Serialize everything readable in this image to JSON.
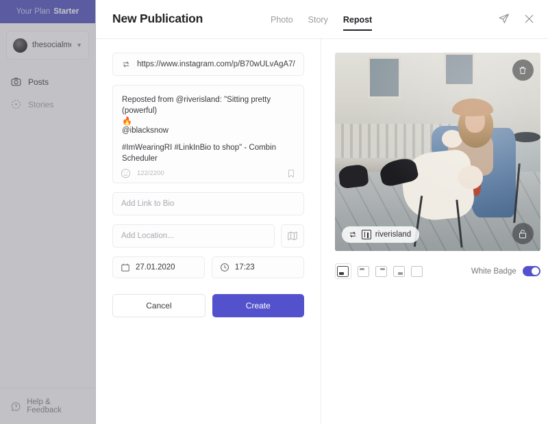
{
  "sidebar": {
    "plan": {
      "label": "Your Plan",
      "name": "Starter"
    },
    "account": {
      "name": "thesocialmed...",
      "chevron": "chevron-down-icon"
    },
    "nav": [
      {
        "label": "Posts",
        "icon": "camera-icon",
        "active": true
      },
      {
        "label": "Stories",
        "icon": "story-circle-icon",
        "active": false
      }
    ],
    "help": {
      "label": "Help & Feedback",
      "icon": "question-mark-icon"
    }
  },
  "modal": {
    "title": "New Publication",
    "tabs": [
      {
        "label": "Photo",
        "active": false
      },
      {
        "label": "Story",
        "active": false
      },
      {
        "label": "Repost",
        "active": true
      }
    ],
    "head_actions": [
      {
        "name": "send-icon"
      },
      {
        "name": "close-icon"
      }
    ],
    "form": {
      "url": {
        "icon": "repost-arrows-icon",
        "value": "https://www.instagram.com/p/B70wULvAgA7/"
      },
      "caption": {
        "line1": "Reposted from @riverisland: \"Sitting pretty (powerful)",
        "emoji": "🔥",
        "line2": "@iblacksnow",
        "line3": "#ImWearingRI #LinkInBio to shop\" - Combin Scheduler",
        "counter": "122/2200",
        "emoji_icon": "emoji-smiley-icon",
        "bookmark_icon": "bookmark-icon"
      },
      "link_to_bio": {
        "placeholder": "Add Link to Bio",
        "value": ""
      },
      "location": {
        "placeholder": "Add Location...",
        "value": "",
        "map_icon": "map-icon"
      },
      "date": {
        "value": "27.01.2020",
        "icon": "calendar-icon"
      },
      "time": {
        "value": "17:23",
        "icon": "clock-icon"
      },
      "cancel_label": "Cancel",
      "create_label": "Create"
    },
    "preview": {
      "delete_icon": "trash-icon",
      "lock_icon": "unlock-icon",
      "badge": {
        "repost_icon": "repost-arrows-icon",
        "logo_icon": "riverisland-logo-icon",
        "username": "riverisland"
      },
      "badge_positions": [
        {
          "name": "badge-position-bottom-left",
          "mark": "m-bl",
          "selected": true
        },
        {
          "name": "badge-position-top-left",
          "mark": "m-tl",
          "selected": false
        },
        {
          "name": "badge-position-top-right",
          "mark": "m-tr",
          "selected": false
        },
        {
          "name": "badge-position-bottom-right",
          "mark": "m-br",
          "selected": false
        },
        {
          "name": "badge-position-none",
          "mark": "",
          "selected": false
        }
      ],
      "white_badge": {
        "label": "White Badge",
        "on": true
      }
    }
  },
  "colors": {
    "accent": "#5352cc",
    "banner": "#4b4bbd",
    "text": "#232327",
    "muted": "#9c9ca2"
  }
}
